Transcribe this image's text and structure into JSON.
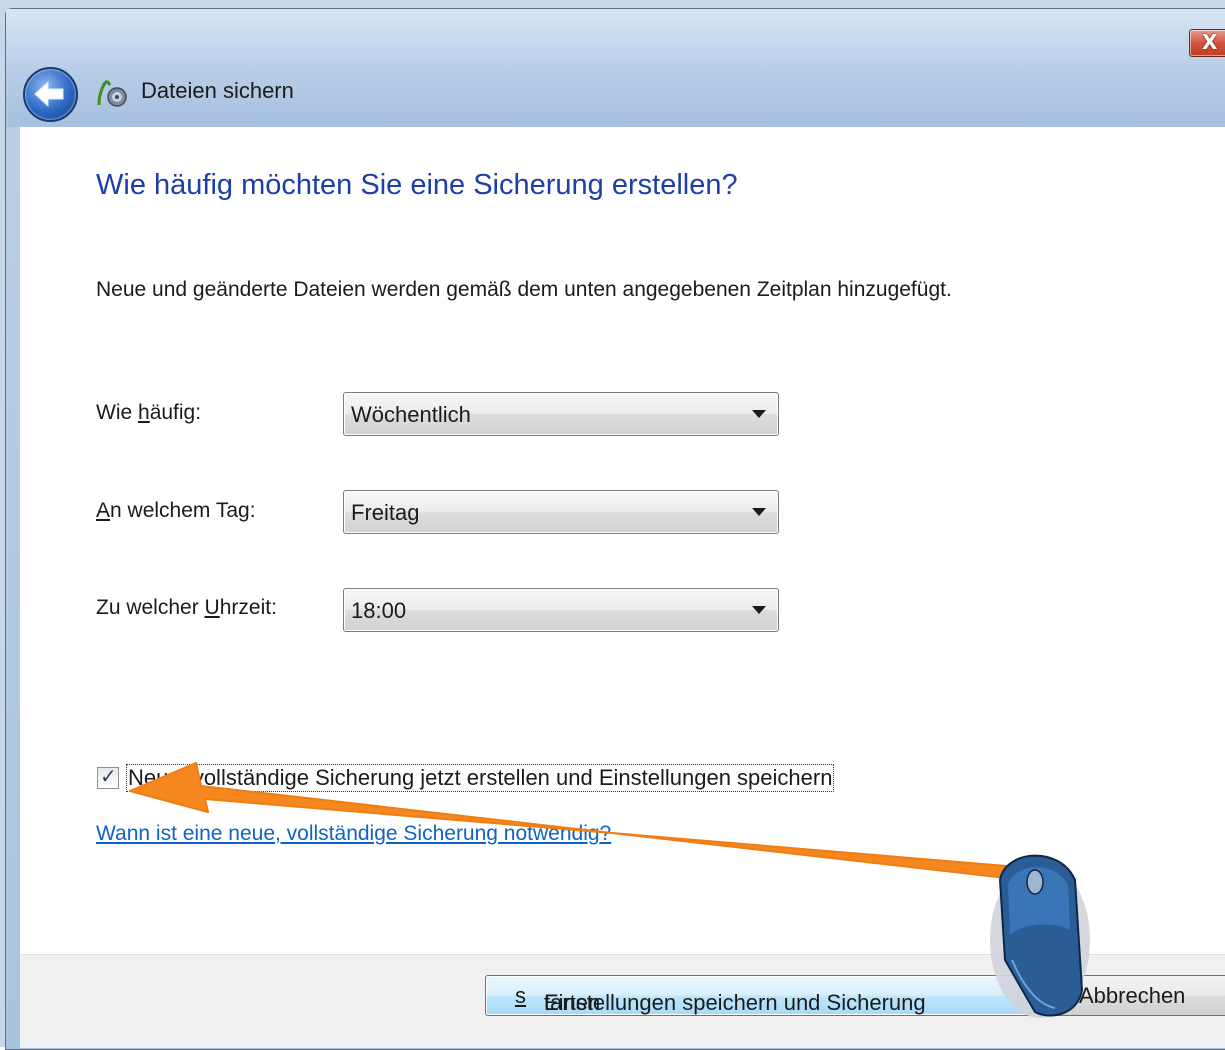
{
  "window": {
    "title": "Dateien sichern",
    "close_glyph": "X",
    "back_icon": "back-arrow-icon",
    "app_icon": "backup-icon"
  },
  "main": {
    "heading": "Wie häufig möchten Sie eine Sicherung erstellen?",
    "description": "Neue und geänderte Dateien werden gemäß dem unten angegebenen Zeitplan hinzugefügt.",
    "fields": [
      {
        "label_before": "Wie ",
        "label_key": "h",
        "label_after": "äufig:",
        "value": "Wöchentlich"
      },
      {
        "label_before": "",
        "label_key": "A",
        "label_after": "n welchem Tag:",
        "value": "Freitag"
      },
      {
        "label_before": "Zu welcher ",
        "label_key": "U",
        "label_after": "hrzeit:",
        "value": "18:00"
      }
    ],
    "checkbox": {
      "checked": true,
      "label": "Neue, vollständige Sicherung jetzt erstellen und Einstellungen speichern"
    },
    "help_link": "Wann ist eine neue, vollständige Sicherung notwendig?"
  },
  "footer": {
    "primary_before": "Einstellungen speichern und Sicherung ",
    "primary_key": "s",
    "primary_after": "tarten",
    "cancel_label": "Abbrechen"
  },
  "overlay": {
    "arrow_color": "#f5871f",
    "mouse_icon": "computer-mouse-icon"
  },
  "colors": {
    "heading": "#1e3ea8",
    "link": "#0d63c9",
    "titlebar": "#b7cce6"
  }
}
